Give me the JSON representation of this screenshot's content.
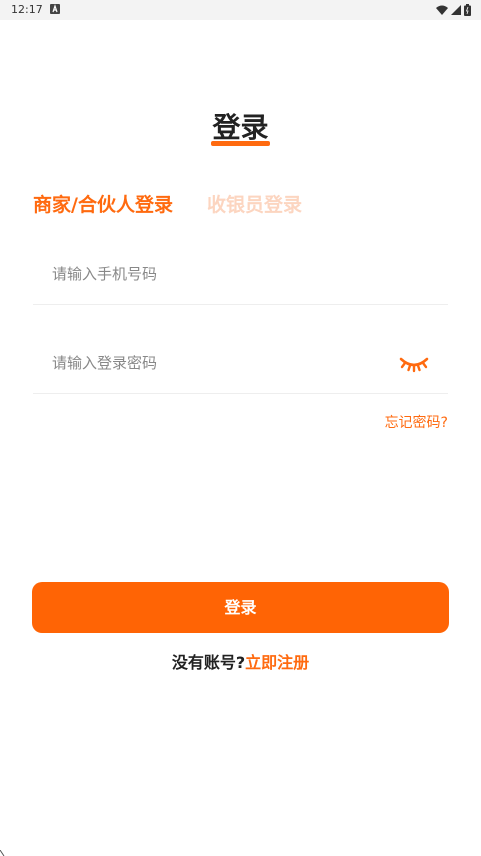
{
  "status_bar": {
    "time": "12:17",
    "icons": [
      "notification-a-icon",
      "wifi-icon",
      "signal-icon",
      "battery-icon"
    ]
  },
  "title": "登录",
  "tabs": [
    {
      "label": "商家/合伙人登录",
      "active": true
    },
    {
      "label": "收银员登录",
      "active": false
    }
  ],
  "form": {
    "phone_placeholder": "请输入手机号码",
    "phone_value": "",
    "password_placeholder": "请输入登录密码",
    "password_value": "",
    "password_toggle_icon": "eye-closed-icon",
    "forgot_password": "忘记密码?"
  },
  "login_button": "登录",
  "register": {
    "prompt": "没有账号?",
    "link": "立即注册"
  },
  "colors": {
    "accent": "#ff6a0f",
    "button": "#ff6405",
    "inactive_tab": "#fcd5c0",
    "placeholder": "#888888"
  }
}
